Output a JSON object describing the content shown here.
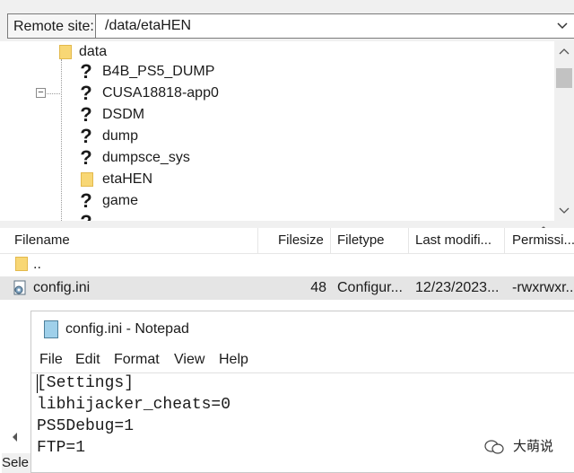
{
  "remote": {
    "label": "Remote site:",
    "path": "/data/etaHEN"
  },
  "tree": {
    "root": "data",
    "items": [
      {
        "label": "B4B_PS5_DUMP",
        "icon": "question-mark-icon"
      },
      {
        "label": "CUSA18818-app0",
        "icon": "question-mark-icon"
      },
      {
        "label": "DSDM",
        "icon": "question-mark-icon"
      },
      {
        "label": "dump",
        "icon": "question-mark-icon"
      },
      {
        "label": "dumpsce_sys",
        "icon": "question-mark-icon"
      },
      {
        "label": "etaHEN",
        "icon": "folder-icon"
      },
      {
        "label": "game",
        "icon": "question-mark-icon"
      }
    ]
  },
  "filelist": {
    "columns": [
      "Filename",
      "Filesize",
      "Filetype",
      "Last modifi...",
      "Permissi..."
    ],
    "rows": [
      {
        "name": "..",
        "size": "",
        "type": "",
        "modified": "",
        "perms": ""
      },
      {
        "name": "config.ini",
        "size": "48",
        "type": "Configur...",
        "modified": "12/23/2023...",
        "perms": "-rwxrwxr..."
      }
    ]
  },
  "notepad": {
    "title": "config.ini - Notepad",
    "menu": [
      "File",
      "Edit",
      "Format",
      "View",
      "Help"
    ],
    "lines": [
      "[Settings]",
      "libhijacker_cheats=0",
      "PS5Debug=1",
      "FTP=1"
    ]
  },
  "status": {
    "partial_text": "Sele"
  },
  "watermark": {
    "text": "大萌说"
  },
  "colors": {
    "selected_row": "#e5e5e5",
    "folder": "#f8d775",
    "chrome": "#f0f0f0"
  }
}
